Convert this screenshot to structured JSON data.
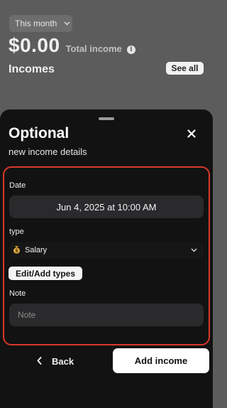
{
  "background": {
    "period": "This month",
    "total_amount": "$0.00",
    "total_label": "Total income",
    "section_title": "Incomes",
    "see_all": "See all"
  },
  "sheet": {
    "title": "Optional",
    "subtitle": "new income details",
    "close": "✕",
    "form": {
      "date_label": "Date",
      "date_value": "Jun 4, 2025 at 10:00 AM",
      "type_label": "type",
      "type_value": "Salary",
      "type_icon": "money-bag-icon",
      "edit_types": "Edit/Add types",
      "note_label": "Note",
      "note_placeholder": "Note"
    },
    "back": "Back",
    "submit": "Add income"
  },
  "colors": {
    "highlight_border": "#d8382a",
    "sheet_bg": "#121212",
    "field_bg": "#2a2a2c"
  }
}
